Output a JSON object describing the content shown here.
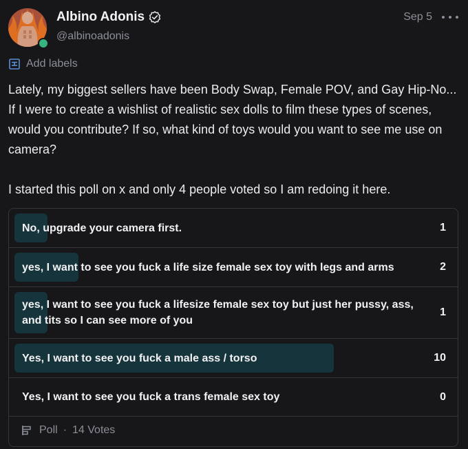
{
  "author": {
    "display_name": "Albino Adonis",
    "handle": "@albinoadonis",
    "verified": true,
    "online": true,
    "status_color": "#36b37e"
  },
  "post": {
    "date": "Sep 5",
    "more_icon": "more-horizontal-icon",
    "add_labels": "Add labels",
    "body_lines": [
      "Lately, my biggest sellers have been Body Swap, Female POV, and Gay Hip-No...",
      "If I were to create a wishlist of realistic sex dolls to film these types of scenes,",
      "would you contribute? If so, what kind of toys would you want to see me use on",
      "camera?",
      "",
      "I started this poll on x and only 4 people voted so I am redoing it here."
    ]
  },
  "poll": {
    "fill_color": "#16343b",
    "options": [
      {
        "label": "No, upgrade your camera first.",
        "votes": "1",
        "share": 0.0714
      },
      {
        "label": "yes, I want to see you fuck a life size female sex toy with legs and arms",
        "votes": "2",
        "share": 0.1429
      },
      {
        "label": "yes, I want to see you fuck a lifesize female sex toy but just her pussy, ass, and tits so I can see more of you",
        "votes": "1",
        "share": 0.0714
      },
      {
        "label": "Yes, I want to see you fuck a male ass / torso",
        "votes": "10",
        "share": 0.7143
      },
      {
        "label": "Yes, I want to see you fuck a trans female sex toy",
        "votes": "0",
        "share": 0
      }
    ],
    "footer_label": "Poll",
    "footer_separator": "·",
    "total_votes": "14 Votes"
  }
}
